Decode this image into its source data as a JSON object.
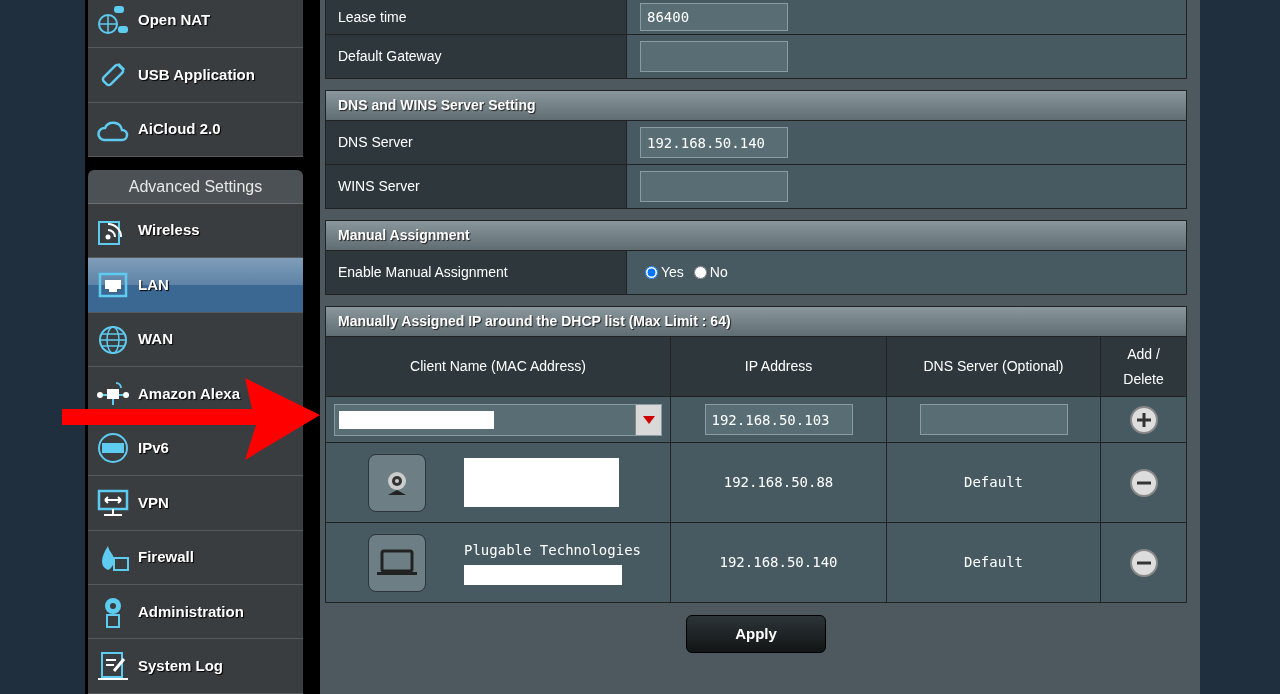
{
  "sidebar": {
    "top_items": [
      {
        "label": "Open NAT",
        "kind": "nat",
        "selected": false
      },
      {
        "label": "USB Application",
        "kind": "usb",
        "selected": false
      },
      {
        "label": "AiCloud 2.0",
        "kind": "cloud",
        "selected": false
      }
    ],
    "advanced": {
      "title": "Advanced Settings",
      "items": [
        {
          "label": "Wireless",
          "kind": "wireless",
          "selected": false
        },
        {
          "label": "LAN",
          "kind": "lan",
          "selected": true
        },
        {
          "label": "WAN",
          "kind": "wan",
          "selected": false
        },
        {
          "label": "Amazon Alexa",
          "kind": "alexa",
          "selected": false
        },
        {
          "label": "IPv6",
          "kind": "ipv6",
          "selected": false
        },
        {
          "label": "VPN",
          "kind": "vpn",
          "selected": false
        },
        {
          "label": "Firewall",
          "kind": "firewall",
          "selected": false
        },
        {
          "label": "Administration",
          "kind": "admin",
          "selected": false
        },
        {
          "label": "System Log",
          "kind": "log",
          "selected": false
        }
      ]
    }
  },
  "dhcp_rows": [
    {
      "label": "Lease time",
      "value": "86400"
    },
    {
      "label": "Default Gateway"
    }
  ],
  "dns_section": {
    "title": "DNS and WINS Server Setting",
    "rows": [
      {
        "label": "DNS Server",
        "value": "192.168.50.140"
      },
      {
        "label": "WINS Server"
      }
    ]
  },
  "manual_section": {
    "title": "Manual Assignment",
    "label": "Enable Manual Assignment",
    "options": [
      {
        "label": "Yes",
        "selected": true
      },
      {
        "label": "No",
        "selected": false
      }
    ]
  },
  "list_section": {
    "title": "Manually Assigned IP around the DHCP list (Max Limit : 64)",
    "columns": [
      "Client Name (MAC Address)",
      "IP Address",
      "DNS Server (Optional)",
      "Add / Delete"
    ],
    "input_row": {
      "ip": "192.168.50.103"
    },
    "rows": [
      {
        "kind": "webcam",
        "ip": "192.168.50.88",
        "dns": "Default"
      },
      {
        "kind": "laptop",
        "name": "Plugable Technologies",
        "ip": "192.168.50.140",
        "dns": "Default"
      }
    ]
  },
  "apply_button": "Apply"
}
